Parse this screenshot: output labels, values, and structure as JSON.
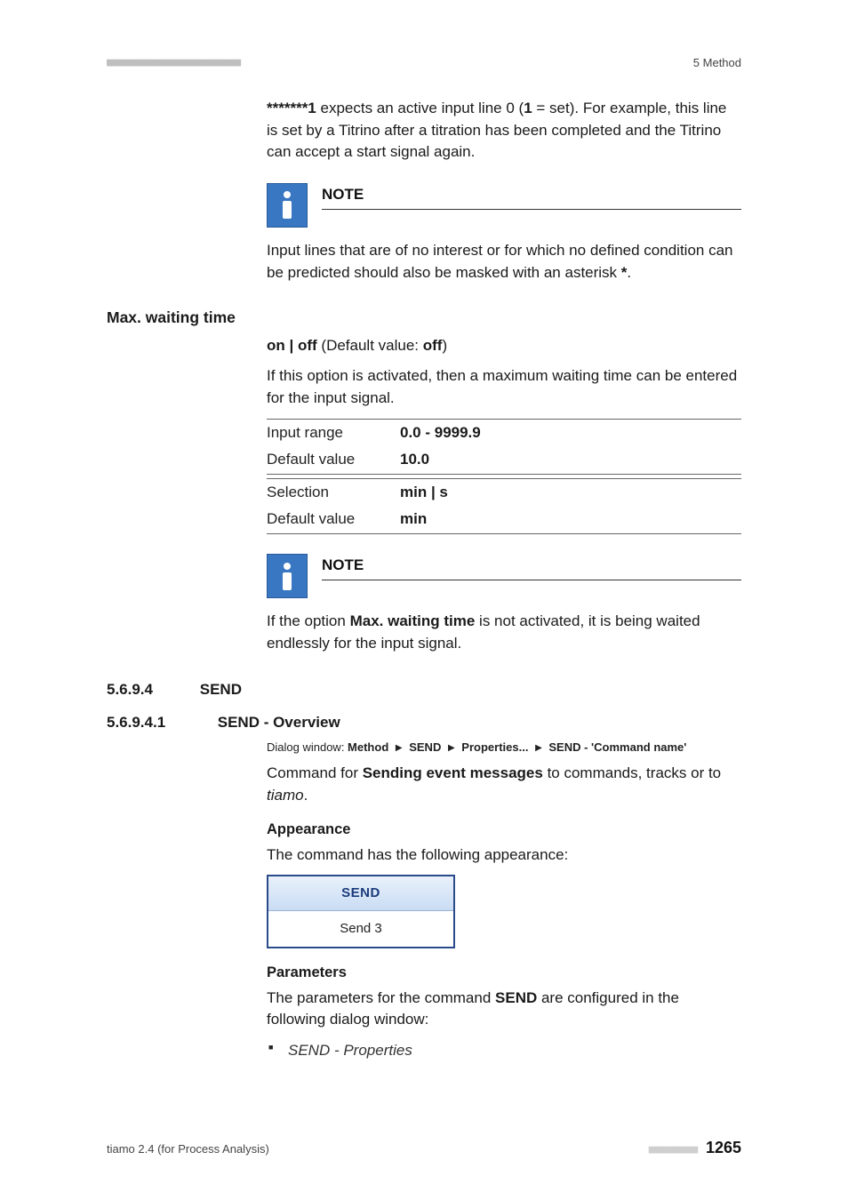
{
  "header": {
    "dots": "■■■■■■■■■■■■■■■■■■■■■■",
    "chapter": "5 Method"
  },
  "intro": {
    "pattern_prefix": "*******1",
    "sentence_part1": " expects an active input line 0 (",
    "one_bold": "1",
    "sentence_part2": " = set). For example, this line is set by a Titrino after a titration has been completed and the Titrino can accept a start signal again."
  },
  "note1": {
    "title": "NOTE",
    "body_part1": "Input lines that are of no interest or for which no defined condition can be predicted should also be masked with an asterisk ",
    "asterisk": "*",
    "body_part2": "."
  },
  "maxwait": {
    "heading": "Max. waiting time",
    "opts_prefix": "on | off",
    "opts_paren_label": " (Default value: ",
    "opts_default": "off",
    "opts_paren_close": ")",
    "desc": "If this option is activated, then a maximum waiting time can be entered for the input signal.",
    "rows": [
      {
        "label": "Input range",
        "value": "0.0 - 9999.9"
      },
      {
        "label": "Default value",
        "value": "10.0"
      },
      {
        "label": "Selection",
        "value": "min | s"
      },
      {
        "label": "Default value",
        "value": "min"
      }
    ]
  },
  "note2": {
    "title": "NOTE",
    "body_part1": "If the option ",
    "bold": "Max. waiting time",
    "body_part2": " is not activated, it is being waited endlessly for the input signal."
  },
  "sec1": {
    "num": "5.6.9.4",
    "title": "SEND"
  },
  "sec2": {
    "num": "5.6.9.4.1",
    "title": "SEND - Overview",
    "dialog_label": "Dialog window: ",
    "path": [
      "Method",
      "SEND",
      "Properties...",
      "SEND - 'Command name'"
    ],
    "cmd_part1": "Command for ",
    "cmd_bold": "Sending event messages",
    "cmd_part2": " to commands, tracks or to ",
    "cmd_italic": "tiamo",
    "cmd_part3": "."
  },
  "appearance": {
    "heading": "Appearance",
    "desc": "The command has the following appearance:",
    "box_top": "SEND",
    "box_bottom": "Send 3"
  },
  "parameters": {
    "heading": "Parameters",
    "desc_part1": "The parameters for the command ",
    "desc_bold": "SEND",
    "desc_part2": " are configured in the following dialog window:",
    "items": [
      "SEND - Properties"
    ]
  },
  "footer": {
    "left": "tiamo 2.4 (for Process Analysis)",
    "dots": "■■■■■■■■",
    "page": "1265"
  }
}
